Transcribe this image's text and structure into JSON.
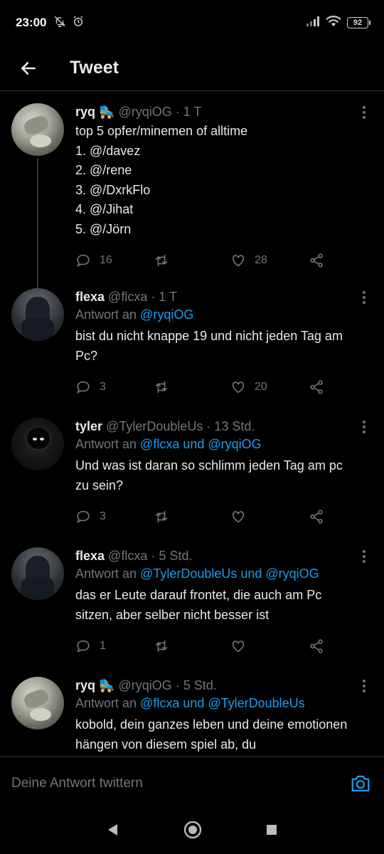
{
  "status": {
    "time": "23:00",
    "battery": "92"
  },
  "header": {
    "title": "Tweet"
  },
  "tweets": [
    {
      "name": "ryq",
      "badge": "🛼",
      "handle": "@ryqiOG",
      "time": "· 1 T",
      "reply_prefix": "",
      "reply_targets": "",
      "text": "top 5 opfer/minemen of alltime\n1. @/davez\n2. @/rene\n3. @/DxrkFlo\n4. @/Jihat\n5. @/Jörn",
      "replies": "16",
      "retweets": "",
      "likes": "28"
    },
    {
      "name": "flexa",
      "badge": "",
      "handle": "@flcxa",
      "time": "· 1 T",
      "reply_prefix": "Antwort an ",
      "reply_targets": "@ryqiOG",
      "text": "bist du nicht knappe 19 und nicht jeden Tag am Pc?",
      "replies": "3",
      "retweets": "",
      "likes": "20"
    },
    {
      "name": "tyler",
      "badge": "",
      "handle": "@TylerDoubleUs",
      "time": "· 13 Std.",
      "reply_prefix": "Antwort an ",
      "reply_targets": "@flcxa und @ryqiOG",
      "text": "Und was ist daran so schlimm jeden Tag am pc zu sein?",
      "replies": "3",
      "retweets": "",
      "likes": ""
    },
    {
      "name": "flexa",
      "badge": "",
      "handle": "@flcxa",
      "time": "· 5 Std.",
      "reply_prefix": "Antwort an ",
      "reply_targets": "@TylerDoubleUs und @ryqiOG",
      "text": "das er Leute darauf frontet, die auch am Pc sitzen, aber selber nicht besser ist",
      "replies": "1",
      "retweets": "",
      "likes": ""
    },
    {
      "name": "ryq",
      "badge": "🛼",
      "handle": "@ryqiOG",
      "time": "· 5 Std.",
      "reply_prefix": "Antwort an ",
      "reply_targets": "@flcxa und @TylerDoubleUs",
      "text": "kobold, dein ganzes leben und deine emotionen hängen von diesem spiel ab, du",
      "replies": "",
      "retweets": "",
      "likes": ""
    }
  ],
  "reply_bar": {
    "placeholder": "Deine Antwort twittern"
  },
  "colors": {
    "accent": "#1d9bf0",
    "muted": "#71767b",
    "background": "#000000",
    "text": "#e7e9ea"
  }
}
